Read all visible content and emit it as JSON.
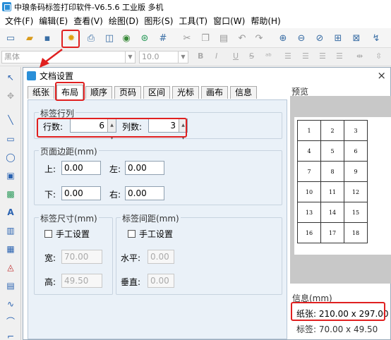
{
  "app": {
    "title": "中琅条码标签打印软件-V6.5.6 工业版 多机"
  },
  "menu": [
    "文件(F)",
    "编辑(E)",
    "查看(V)",
    "绘图(D)",
    "图形(S)",
    "工具(T)",
    "窗口(W)",
    "帮助(H)"
  ],
  "format_bar": {
    "font_value": "黑体",
    "size_value": "10.0",
    "bold": "B",
    "italic": "I",
    "underline": "U",
    "strike": "S"
  },
  "colors": {
    "highlight": "#e02020",
    "panel_bg": "#eaf1f8",
    "accent": "#2a8fd8"
  },
  "dialog": {
    "title": "文档设置",
    "close": "×",
    "tabs": [
      "纸张",
      "布局",
      "顺序",
      "页码",
      "区间",
      "光标",
      "画布",
      "信息"
    ],
    "active_tab": "布局",
    "rows_cols": {
      "title": "标签行列",
      "rows_label": "行数:",
      "rows_value": "6",
      "cols_label": "列数:",
      "cols_value": "3"
    },
    "margins": {
      "title": "页面边距(mm)",
      "top_label": "上:",
      "top_value": "0.00",
      "left_label": "左:",
      "left_value": "0.00",
      "bottom_label": "下:",
      "bottom_value": "0.00",
      "right_label": "右:",
      "right_value": "0.00"
    },
    "label_size": {
      "title": "标签尺寸(mm)",
      "manual_label": "手工设置",
      "width_label": "宽:",
      "width_value": "70.00",
      "height_label": "高:",
      "height_value": "49.50"
    },
    "label_spacing": {
      "title": "标签间距(mm)",
      "manual_label": "手工设置",
      "h_label": "水平:",
      "h_value": "0.00",
      "v_label": "垂直:",
      "v_value": "0.00"
    },
    "preview": {
      "title": "预览",
      "cells": [
        "1",
        "2",
        "3",
        "4",
        "5",
        "6",
        "7",
        "8",
        "9",
        "10",
        "11",
        "12",
        "13",
        "14",
        "15",
        "16",
        "17",
        "18"
      ]
    },
    "info": {
      "title": "信息(mm)",
      "paper": "纸张: 210.00 x 297.00",
      "label": "标签: 70.00 x 49.50"
    }
  }
}
